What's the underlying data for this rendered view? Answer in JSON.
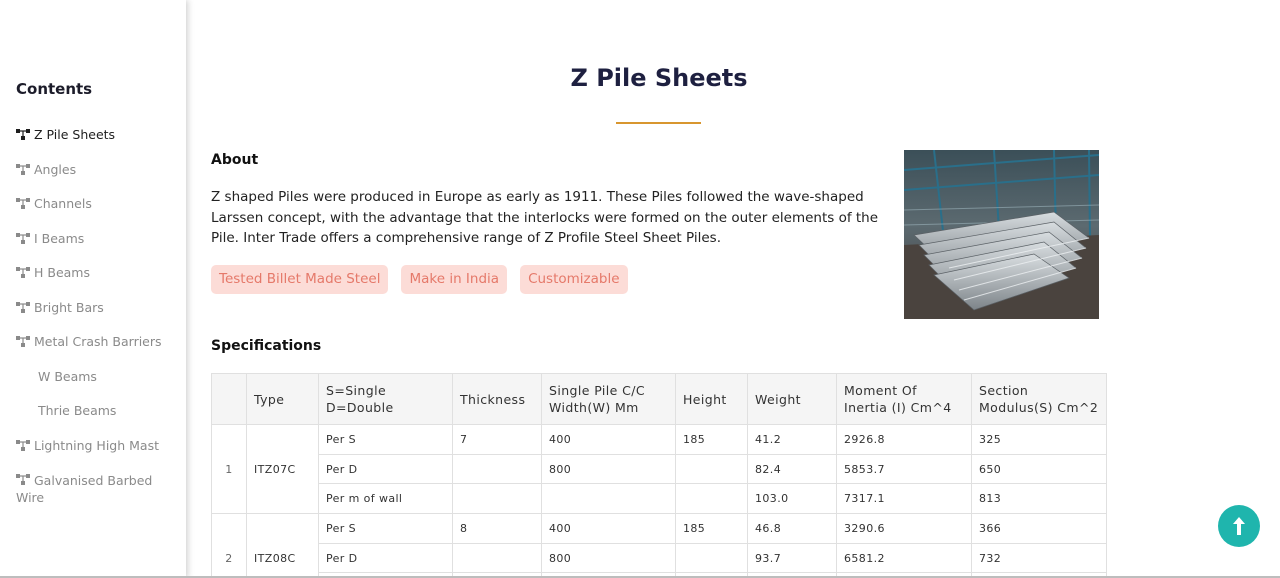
{
  "sidebar": {
    "title": "Contents",
    "items": [
      {
        "label": "Z Pile Sheets",
        "active": true,
        "sub": false
      },
      {
        "label": "Angles",
        "active": false,
        "sub": false
      },
      {
        "label": "Channels",
        "active": false,
        "sub": false
      },
      {
        "label": "I Beams",
        "active": false,
        "sub": false
      },
      {
        "label": "H Beams",
        "active": false,
        "sub": false
      },
      {
        "label": "Bright Bars",
        "active": false,
        "sub": false
      },
      {
        "label": "Metal Crash Barriers",
        "active": false,
        "sub": false
      },
      {
        "label": "W Beams",
        "active": false,
        "sub": true
      },
      {
        "label": "Thrie Beams",
        "active": false,
        "sub": true
      },
      {
        "label": "Lightning High Mast",
        "active": false,
        "sub": false
      },
      {
        "label": "Galvanised Barbed Wire",
        "active": false,
        "sub": false
      }
    ]
  },
  "page": {
    "title": "Z Pile Sheets",
    "accent_color": "#d8962f"
  },
  "about": {
    "heading": "About",
    "text": "Z shaped Piles were produced in Europe as early as 1911. These Piles followed the wave-shaped Larssen concept, with the advantage that the interlocks were formed on the outer elements of the Pile. Inter Trade offers a comprehensive range of Z Profile Steel Sheet Piles.",
    "tags": [
      "Tested Billet Made Steel",
      "Make in India",
      "Customizable"
    ],
    "tag_bg_color": "#fcdcd7",
    "tag_text_color": "#e5796a"
  },
  "specifications": {
    "heading": "Specifications",
    "headers": [
      "",
      "Type",
      "S=Single D=Double",
      "Thickness",
      "Single Pile C/C Width(W) Mm",
      "Height",
      "Weight",
      "Moment Of Inertia (I) Cm^4",
      "Section Modulus(S) Cm^2"
    ],
    "groups": [
      {
        "index": "1",
        "type": "ITZ07C",
        "rows": [
          [
            "Per S",
            "7",
            "400",
            "185",
            "41.2",
            "2926.8",
            "325"
          ],
          [
            "Per D",
            "",
            "800",
            "",
            "82.4",
            "5853.7",
            "650"
          ],
          [
            "Per m of wall",
            "",
            "",
            "",
            "103.0",
            "7317.1",
            "813"
          ]
        ]
      },
      {
        "index": "2",
        "type": "ITZ08C",
        "rows": [
          [
            "Per S",
            "8",
            "400",
            "185",
            "46.8",
            "3290.6",
            "366"
          ],
          [
            "Per D",
            "",
            "800",
            "",
            "93.7",
            "6581.2",
            "732"
          ],
          [
            "",
            "",
            "",
            "",
            "",
            "",
            ""
          ]
        ]
      }
    ]
  },
  "scroll_top": {
    "icon": "arrow-up-icon",
    "color": "#1fb5ad"
  }
}
